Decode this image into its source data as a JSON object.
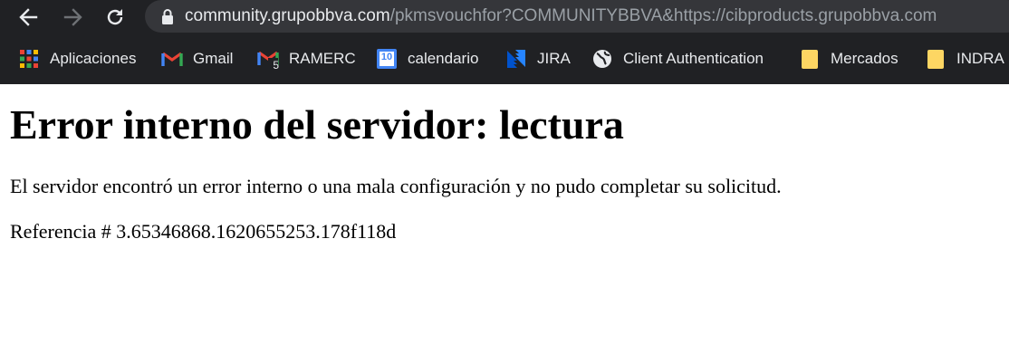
{
  "browser": {
    "url_host": "community.grupobbva.com",
    "url_path": "/pkmsvouchfor?COMMUNITYBBVA&https://cibproducts.grupobbva.com",
    "bookmarks": [
      {
        "label": "Aplicaciones",
        "icon": "apps-grid-icon"
      },
      {
        "label": "Gmail",
        "icon": "gmail-icon"
      },
      {
        "label": "RAMERC",
        "icon": "gmail-badge-icon",
        "badge": "5"
      },
      {
        "label": "calendario",
        "icon": "calendar-icon",
        "badge": "10"
      },
      {
        "label": "JIRA",
        "icon": "jira-icon"
      },
      {
        "label": "Client Authentication",
        "icon": "globe-icon"
      },
      {
        "label": "Mercados",
        "icon": "folder-icon"
      },
      {
        "label": "INDRA",
        "icon": "folder-icon"
      }
    ],
    "colors": {
      "toolbar": "#202124",
      "omnibox": "#35363a",
      "text": "#e8eaed",
      "muted": "#9aa0a6"
    }
  },
  "page": {
    "title": "Error interno del servidor: lectura",
    "message": "El servidor encontró un error interno o una mala configuración y no pudo completar su solicitud.",
    "reference": "Referencia # 3.65346868.1620655253.178f118d"
  }
}
